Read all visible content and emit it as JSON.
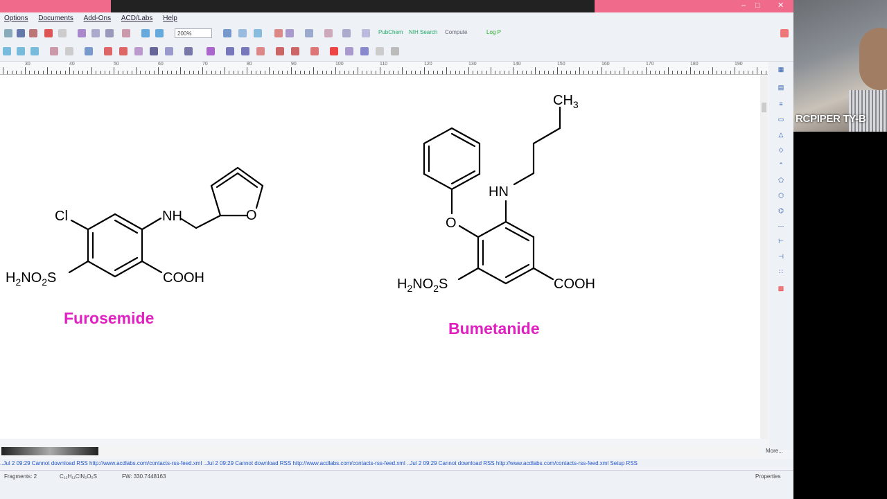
{
  "menu": [
    "Options",
    "Documents",
    "Add-Ons",
    "ACD/Labs",
    "Help"
  ],
  "toolbar": {
    "zoom": "200%",
    "links": [
      "PubChem",
      "NIH Search",
      "Compute",
      "Log P"
    ]
  },
  "ruler_marks": [
    "30",
    "40",
    "50",
    "60",
    "70",
    "80",
    "90",
    "100",
    "110",
    "120",
    "130",
    "140",
    "150",
    "160",
    "170",
    "180",
    "190"
  ],
  "molecules": {
    "furosemide": {
      "name": "Furosemide",
      "atoms": {
        "cl": "Cl",
        "nh": "NH",
        "o_furan": "O",
        "sulfonamide": "H2NO2S",
        "acid": "COOH"
      }
    },
    "bumetanide": {
      "name": "Bumetanide",
      "atoms": {
        "ch3": "CH3",
        "hn": "HN",
        "o_ether": "O",
        "sulfonamide": "H2NO2S",
        "acid": "COOH"
      }
    }
  },
  "scroll": {
    "more": "More..."
  },
  "log": "..Jul 2 09:29 Cannot download RSS http://www.acdlabs.com/contacts-rss-feed.xml ..Jul 2 09:29 Cannot download RSS http://www.acdlabs.com/contacts-rss-feed.xml ..Jul 2 09:29 Cannot download RSS http://www.acdlabs.com/contacts-rss-feed.xml  Setup RSS",
  "status": {
    "fragments": "Fragments: 2",
    "formula": "C₁₂H₁₁ClN₂O₅S",
    "fw": "FW: 330.7448163",
    "properties": "Properties"
  },
  "webcam": {
    "participant": "RCPIPER TY-B"
  },
  "colors": {
    "accent_title": "#f06a8c",
    "compound_label": "#e020c0"
  }
}
